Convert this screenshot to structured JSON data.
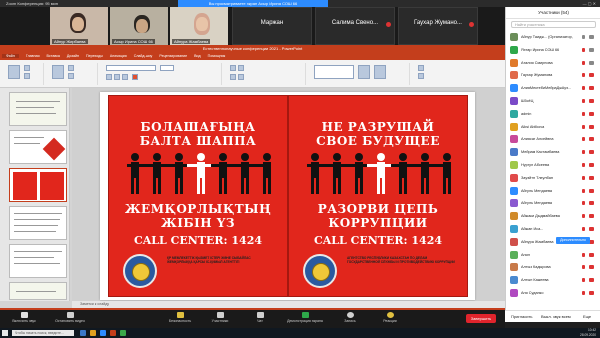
{
  "titlebar": {
    "title": "Zoom Конференция: 95 мин",
    "window_controls": "—  ▢  ✕"
  },
  "share_banner": {
    "text": "Вы просматриваете экран Асыр Ирина СОШ 66"
  },
  "video": {
    "tiles": [
      {
        "name": "Айнур Жирбаева"
      },
      {
        "name": "Асыр Ирина СОШ 66"
      },
      {
        "name": "Айнура Жамбаева"
      },
      {
        "name": "Маржан"
      },
      {
        "name": "Салима Свено..."
      },
      {
        "name": "Гаухар Жумано..."
      }
    ]
  },
  "ppt": {
    "title": "Естественнонаучные конференции 2021 - PowerPoint",
    "tabs": [
      "Файл",
      "Главная",
      "Вставка",
      "Дизайн",
      "Переходы",
      "Анимация",
      "Слайд-шоу",
      "Рецензирование",
      "Вид",
      "Помощник"
    ],
    "notes_placeholder": "Заметки к слайду",
    "slides": [
      "1",
      "2",
      "3",
      "4",
      "5",
      "6"
    ],
    "selected_slide": 3
  },
  "slide": {
    "left_poster": {
      "line1": "БОЛАШАҒЫҢА",
      "line2": "БАЛТА ШАППА",
      "line3": "ЖЕМҚОРЛЫҚТЫҢ",
      "line4": "ЖІБІН ҮЗ",
      "call_center": "CALL CENTER: 1424",
      "small_text": "ҚР МЕМЛЕКЕТТІК ҚЫЗМЕТ ІСТЕРІ ЖӘНЕ СЫБАЙЛАС ЖЕМҚОРЛЫҚҚА ҚАРСЫ ІС-ҚИМЫЛ АГЕНТТІГІ"
    },
    "right_poster": {
      "line1": "НЕ РАЗРУШАЙ",
      "line2": "СВОЕ БУДУЩЕЕ",
      "line3": "РАЗОРВИ ЦЕПЬ",
      "line4": "КОРРУПЦИИ",
      "call_center": "CALL CENTER: 1424",
      "small_text": "АГЕНТСТВО РЕСПУБЛИКИ КАЗАХСТАН ПО ДЕЛАМ ГОСУДАРСТВЕННОЙ СЛУЖБЫ И ПРОТИВОДЕЙСТВИЮ КОРРУПЦИИ"
    }
  },
  "participants": {
    "header": "Участники (54)",
    "search_placeholder": "Найти участника",
    "list": [
      {
        "name": "Айнур Таидж... (Организатор, я)",
        "color": "#6b8e5a"
      },
      {
        "name": "Яхтар Ирина СОШ 66",
        "color": "#2ea84a"
      },
      {
        "name": "Аталия Смирнова",
        "color": "#e07a2b"
      },
      {
        "name": "Гаухар Жуманова",
        "color": "#e06a4a"
      },
      {
        "name": "АлияМектебиМейраДжАуэ...",
        "color": "#2d8cff"
      },
      {
        "name": "Ш5сёЦ",
        "color": "#7a4ac8"
      },
      {
        "name": "admin",
        "color": "#2ea8a0"
      },
      {
        "name": "Aiksi Abilkova",
        "color": "#e0a020"
      },
      {
        "name": "Алиясаг Алсейвна",
        "color": "#c84a9a"
      },
      {
        "name": "Мейрам Кастамбаева",
        "color": "#4a7ac8"
      },
      {
        "name": "Нургул Абсеева",
        "color": "#a0c84a"
      },
      {
        "name": "Зауэйтн Тлеулбан",
        "color": "#e04a4a"
      },
      {
        "name": "Айгуль Мендаева",
        "color": "#2d8cff"
      },
      {
        "name": "Айгуль Мендаева",
        "color": "#8a5ad0"
      },
      {
        "name": "Айжаки Дыдмайбаева",
        "color": "#d08a2a"
      },
      {
        "name": "Айжан Иса...",
        "color": "#3aa0d0"
      },
      {
        "name": "Айнура Жамбаева",
        "color": "#d0504a"
      },
      {
        "name": "Анил",
        "color": "#5ab05a"
      },
      {
        "name": "Алтыз Кадырова",
        "color": "#c87a4a"
      },
      {
        "name": "Алтын Кажеева",
        "color": "#4a8ad0"
      },
      {
        "name": "Аня Судапко",
        "color": "#b04ac0"
      }
    ],
    "promote_label": "Дополнительно",
    "footer": {
      "invite": "Пригласить",
      "mute_all": "Выкл. звук всем",
      "more": "Еще"
    }
  },
  "controls": {
    "items": [
      "Включить звук",
      "Остановить видео",
      "Безопасность",
      "Участники",
      "Чат",
      "Демонстрация экрана",
      "Запись",
      "Реакции"
    ],
    "participants_count": "54",
    "end_label": "Завершить"
  },
  "taskbar": {
    "search_placeholder": "Чтобы начать поиск, введите...",
    "time": "10:42",
    "date": "28.09.2020"
  }
}
